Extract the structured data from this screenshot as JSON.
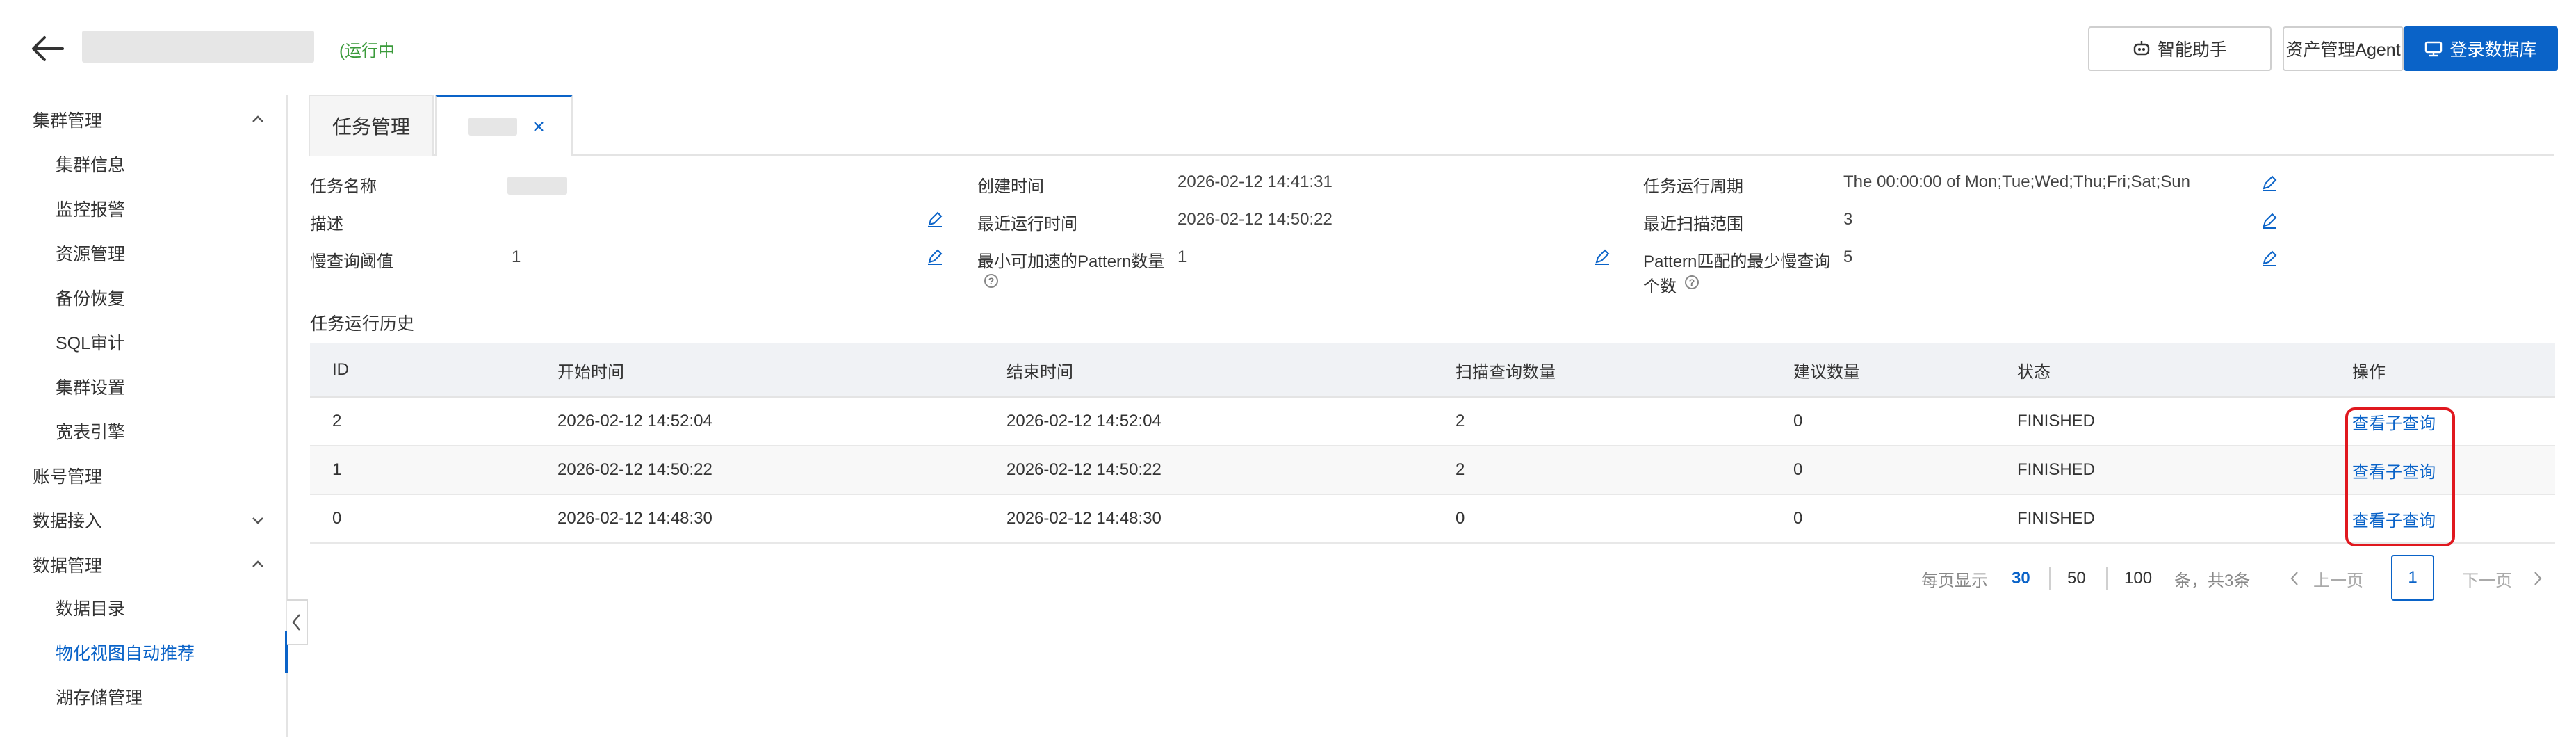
{
  "header": {
    "run_status": "(运行中",
    "buttons": {
      "assistant": "智能助手",
      "asset_agent": "资产管理Agent",
      "login_db": "登录数据库"
    }
  },
  "sidebar": {
    "items": [
      {
        "label": "集群管理",
        "kind": "group",
        "chevron": "up"
      },
      {
        "label": "集群信息",
        "kind": "sub"
      },
      {
        "label": "监控报警",
        "kind": "sub"
      },
      {
        "label": "资源管理",
        "kind": "sub"
      },
      {
        "label": "备份恢复",
        "kind": "sub"
      },
      {
        "label": "SQL审计",
        "kind": "sub"
      },
      {
        "label": "集群设置",
        "kind": "sub"
      },
      {
        "label": "宽表引擎",
        "kind": "sub"
      },
      {
        "label": "账号管理",
        "kind": "group"
      },
      {
        "label": "数据接入",
        "kind": "group",
        "chevron": "down"
      },
      {
        "label": "数据管理",
        "kind": "group",
        "chevron": "up"
      },
      {
        "label": "数据目录",
        "kind": "sub"
      },
      {
        "label": "物化视图自动推荐",
        "kind": "sub",
        "active": true
      },
      {
        "label": "湖存储管理",
        "kind": "sub"
      }
    ]
  },
  "tabs": {
    "task_management": "任务管理"
  },
  "info": {
    "task_name_label": "任务名称",
    "description_label": "描述",
    "slow_query_threshold_label": "慢查询阈值",
    "slow_query_threshold_value": "1",
    "created_time_label": "创建时间",
    "created_time_value": "2026-02-12 14:41:31",
    "last_run_label": "最近运行时间",
    "last_run_value": "2026-02-12 14:50:22",
    "min_pattern_label": "最小可加速的Pattern数量",
    "min_pattern_value": "1",
    "cycle_label": "任务运行周期",
    "cycle_value": "The 00:00:00 of Mon;Tue;Wed;Thu;Fri;Sat;Sun",
    "scan_range_label": "最近扫描范围",
    "scan_range_value": "3",
    "pattern_min_slow_label_1": "Pattern匹配的最少慢查询",
    "pattern_min_slow_label_2": "个数",
    "pattern_min_slow_value": "5"
  },
  "history": {
    "title": "任务运行历史",
    "columns": [
      "ID",
      "开始时间",
      "结束时间",
      "扫描查询数量",
      "建议数量",
      "状态",
      "操作"
    ],
    "rows": [
      {
        "id": "2",
        "start": "2026-02-12 14:52:04",
        "end": "2026-02-12 14:52:04",
        "scanned": "2",
        "suggestions": "0",
        "status": "FINISHED",
        "action": "查看子查询"
      },
      {
        "id": "1",
        "start": "2026-02-12 14:50:22",
        "end": "2026-02-12 14:50:22",
        "scanned": "2",
        "suggestions": "0",
        "status": "FINISHED",
        "action": "查看子查询"
      },
      {
        "id": "0",
        "start": "2026-02-12 14:48:30",
        "end": "2026-02-12 14:48:30",
        "scanned": "0",
        "suggestions": "0",
        "status": "FINISHED",
        "action": "查看子查询"
      }
    ]
  },
  "pagination": {
    "per_page_label": "每页显示",
    "sizes": [
      "30",
      "50",
      "100"
    ],
    "selected_size": "30",
    "total": "条，共3条",
    "prev": "上一页",
    "current": "1",
    "next": "下一页"
  },
  "colors": {
    "primary": "#0a63c8",
    "running": "#3a9a3a",
    "highlight": "#e0181f"
  }
}
